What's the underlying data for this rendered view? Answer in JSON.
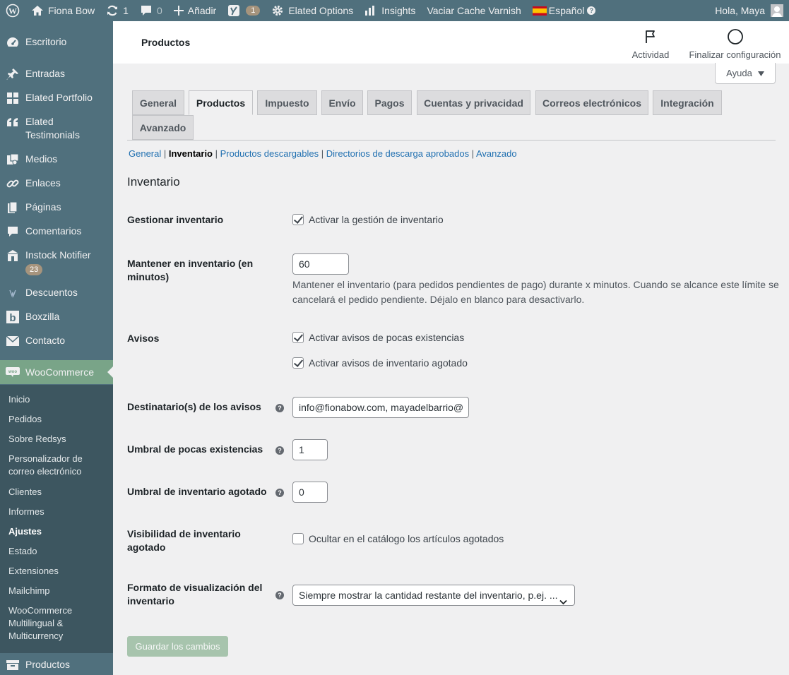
{
  "adminbar": {
    "site_name": "Fiona Bow",
    "updates_count": "1",
    "comments_count": "0",
    "add_label": "Añadir",
    "yoast_count": "1",
    "elated_options": "Elated Options",
    "insights": "Insights",
    "varnish": "Vaciar Cache Varnish",
    "language": "Español",
    "greeting": "Hola, Maya"
  },
  "sidebar": {
    "items": [
      {
        "label": "Escritorio",
        "icon": "dashboard-icon"
      },
      {
        "label": "Entradas",
        "icon": "pin-icon"
      },
      {
        "label": "Elated Portfolio",
        "icon": "grid-icon"
      },
      {
        "label": "Elated Testimonials",
        "icon": "quote-icon"
      },
      {
        "label": "Medios",
        "icon": "media-icon"
      },
      {
        "label": "Enlaces",
        "icon": "link-icon"
      },
      {
        "label": "Páginas",
        "icon": "pages-icon"
      },
      {
        "label": "Comentarios",
        "icon": "comment-icon"
      },
      {
        "label": "Instock Notifier",
        "icon": "store-icon",
        "badge": "23"
      },
      {
        "label": "Descuentos",
        "icon": "discount-icon"
      },
      {
        "label": "Boxzilla",
        "icon": "boxzilla-icon"
      },
      {
        "label": "Contacto",
        "icon": "mail-icon"
      },
      {
        "label": "WooCommerce",
        "icon": "woo-icon"
      }
    ],
    "submenu": [
      "Inicio",
      "Pedidos",
      "Sobre Redsys",
      "Personalizador de correo electrónico",
      "Clientes",
      "Informes",
      "Ajustes",
      "Estado",
      "Extensiones",
      "Mailchimp",
      "WooCommerce Multilingual & Multicurrency"
    ],
    "submenu_current": "Ajustes",
    "bottom_item": "Productos"
  },
  "header": {
    "title": "Productos",
    "activity": "Actividad",
    "finish_setup": "Finalizar configuración"
  },
  "help_label": "Ayuda",
  "tabs": [
    "General",
    "Productos",
    "Impuesto",
    "Envío",
    "Pagos",
    "Cuentas y privacidad",
    "Correos electrónicos",
    "Integración",
    "Avanzado"
  ],
  "subsections": {
    "general": "General",
    "inventario": "Inventario",
    "descargables": "Productos descargables",
    "directorios": "Directorios de descarga aprobados",
    "avanzado": "Avanzado"
  },
  "section_title": "Inventario",
  "form": {
    "manage_label": "Gestionar inventario",
    "manage_cb": "Activar la gestión de inventario",
    "hold_label": "Mantener en inventario (en minutos)",
    "hold_value": "60",
    "hold_desc": "Mantener el inventario (para pedidos pendientes de pago) durante x minutos. Cuando se alcance este límite se cancelará el pedido pendiente. Déjalo en blanco para desactivarlo.",
    "notices_label": "Avisos",
    "low_stock_cb": "Activar avisos de pocas existencias",
    "out_stock_cb": "Activar avisos de inventario agotado",
    "recipient_label": "Destinatario(s) de los avisos",
    "recipient_value": "info@fionabow.com, mayadelbarrio@",
    "low_threshold_label": "Umbral de pocas existencias",
    "low_threshold_value": "1",
    "out_threshold_label": "Umbral de inventario agotado",
    "out_threshold_value": "0",
    "visibility_label": "Visibilidad de inventario agotado",
    "visibility_cb": "Ocultar en el catálogo los artículos agotados",
    "format_label": "Formato de visualización del inventario",
    "format_value": "Siempre mostrar la cantidad restante del inventario, p.ej. ..."
  },
  "save_label": "Guardar los cambios",
  "help_tip_glyph": "?"
}
